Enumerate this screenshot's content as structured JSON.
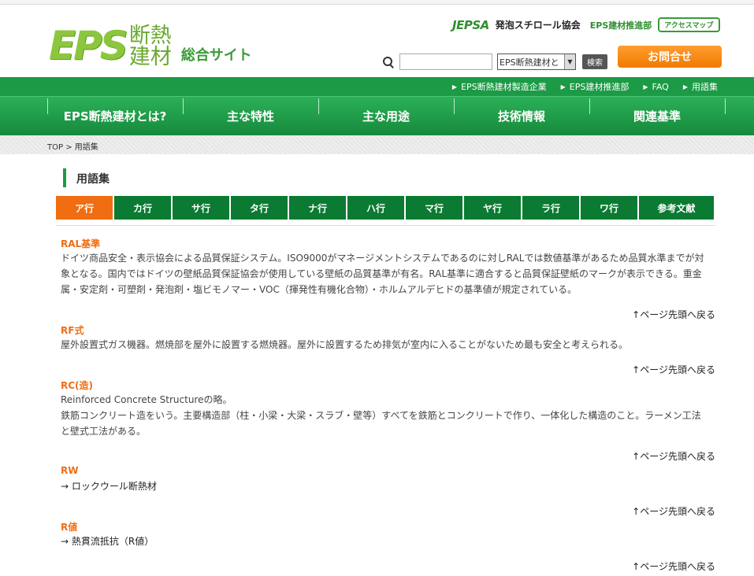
{
  "header": {
    "logo_eps": "EPS",
    "logo_jp_line1": "断熱",
    "logo_jp_line2": "建材",
    "logo_site": "総合サイト",
    "jepsa_logo": "JEPSA",
    "jepsa_name": "発泡スチロール協会",
    "jepsa_division": "EPS建材推進部",
    "access_map": "アクセスマップ",
    "search_input_value": "",
    "search_select_value": "EPS断熱建材と",
    "search_button": "検索",
    "contact_button": "お問合せ"
  },
  "subnav": {
    "items": [
      "EPS断熱建材製造企業",
      "EPS建材推進部",
      "FAQ",
      "用語集"
    ]
  },
  "mainnav": {
    "items": [
      "EPS断熱建材とは?",
      "主な特性",
      "主な用途",
      "技術情報",
      "関連基準"
    ]
  },
  "breadcrumb": {
    "text": "TOP > 用語集"
  },
  "page": {
    "title": "用語集"
  },
  "tabs": {
    "items": [
      "ア行",
      "カ行",
      "サ行",
      "タ行",
      "ナ行",
      "ハ行",
      "マ行",
      "ヤ行",
      "ラ行",
      "ワ行",
      "参考文献"
    ],
    "active": "ア行"
  },
  "entries": [
    {
      "term": "RAL基準",
      "lines": [
        "ドイツ商品安全・表示協会による品質保証システム。ISO9000がマネージメントシステムであるのに対しRALでは数値基準があるため品質水準までが対",
        "象となる。国内ではドイツの壁紙品質保証協会が使用している壁紙の品質基準が有名。RAL基準に適合すると品質保証壁紙のマークが表示できる。重金",
        "属・安定剤・可塑剤・発泡剤・塩ビモノマー・VOC（揮発性有機化合物）・ホルムアルデヒドの基準値が規定されている。"
      ]
    },
    {
      "term": "RF式",
      "lines": [
        "屋外設置式ガス機器。燃焼部を屋外に設置する燃焼器。屋外に設置するため排気が室内に入ることがないため最も安全と考えられる。"
      ]
    },
    {
      "term": "RC(造)",
      "lines": [
        "Reinforced Concrete Structureの略。",
        "鉄筋コンクリート造をいう。主要構造部（柱・小梁・大梁・スラブ・壁等）すべてを鉄筋とコンクリートで作り、一体化した構造のこと。ラーメン工法",
        "と壁式工法がある。"
      ]
    },
    {
      "term": "RW",
      "lines": [
        "→ ロックウール断熱材"
      ]
    },
    {
      "term": "R値",
      "lines": [
        "→ 熱貫流抵抗（R値）"
      ]
    }
  ],
  "back_to_top": "↑ページ先頭へ戻る"
}
